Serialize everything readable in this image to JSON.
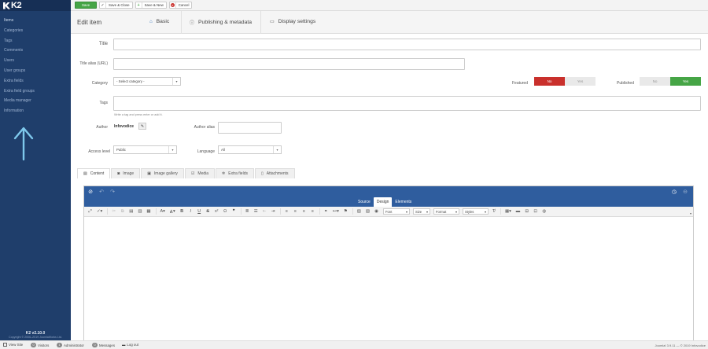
{
  "app": {
    "logo_text": "K2",
    "version": "K2 v2.10.0",
    "copyright": "Copyright © 2006–2019 JoomlaWorks Ltd."
  },
  "sidebar": {
    "items": [
      {
        "label": "Items"
      },
      {
        "label": "Categories"
      },
      {
        "label": "Tags"
      },
      {
        "label": "Comments"
      },
      {
        "label": "Users"
      },
      {
        "label": "User groups"
      },
      {
        "label": "Extra fields"
      },
      {
        "label": "Extra field groups"
      },
      {
        "label": "Media manager"
      },
      {
        "label": "Information"
      }
    ]
  },
  "toolbar": {
    "save": "Save",
    "save_close": "Save & Close",
    "save_new": "Save & New",
    "cancel": "Cancel"
  },
  "header": {
    "title": "Edit item",
    "tabs": [
      "Basic",
      "Publishing & metadata",
      "Display settings"
    ]
  },
  "form": {
    "title_label": "Title",
    "title_value": "",
    "alias_label": "Title alias (URL)",
    "alias_value": "",
    "category_label": "Category",
    "category_value": "- Select category -",
    "featured_label": "Featured",
    "featured_no": "No",
    "featured_yes": "Yes",
    "published_label": "Published",
    "published_no": "No",
    "published_yes": "Yes",
    "tags_label": "Tags",
    "tags_hint": "Write a tag and press enter or add it.",
    "author_label": "Author",
    "author_value": "Infovodice",
    "author_alias_label": "Author alias",
    "author_alias_value": "",
    "access_label": "Access level",
    "access_value": "Public",
    "language_label": "Language",
    "language_value": "All"
  },
  "content_tabs": [
    "Content",
    "Image",
    "Image gallery",
    "Media",
    "Extra fields",
    "Attachments"
  ],
  "editor": {
    "modes": [
      "Source",
      "Design",
      "Elements"
    ],
    "dropdowns": [
      "Font",
      "Size",
      "Format",
      "Styles"
    ]
  },
  "footer": {
    "view_site": "View Site",
    "visitors_count": "0",
    "visitors": "Visitors",
    "admin_count": "1",
    "admin": "Administrator",
    "messages_count": "0",
    "messages": "Messages",
    "logout": "Log out",
    "right": "Joomla! 3.9.11 — © 2019 Infovodice"
  },
  "colors": {
    "sidebar": "#1f3e6b",
    "editor_bar": "#2f5d9e",
    "save": "#46a546",
    "no": "#c9302c",
    "yes": "#46a546",
    "arrow": "#7ec8ec"
  },
  "icons": {
    "basic": "home-icon",
    "publishing": "info-icon",
    "display": "monitor-icon"
  }
}
